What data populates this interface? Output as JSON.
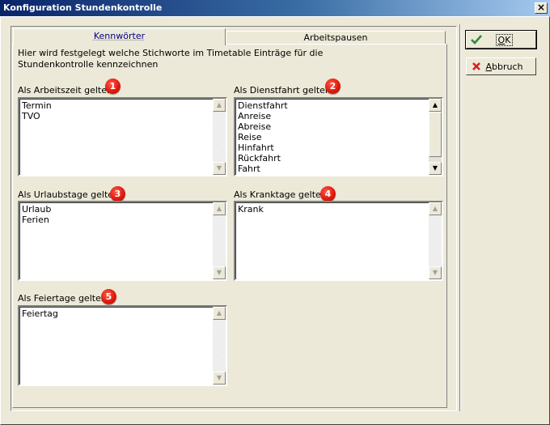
{
  "window": {
    "title": "Konfiguration Stundenkontrolle",
    "close_glyph": "×"
  },
  "tabs": [
    {
      "label": "Kennwörter",
      "active": true
    },
    {
      "label": "Arbeitspausen",
      "active": false
    }
  ],
  "description": "Hier wird festgelegt welche Stichworte im Timetable Einträge für die Stundenkontrolle kennzeichnen",
  "groups": {
    "arbeitszeit": {
      "label": "Als Arbeitszeit gelten:",
      "badge": "1",
      "items": [
        "Termin",
        "TVO"
      ]
    },
    "dienstfahrt": {
      "label": "Als Dienstfahrt gelten:",
      "badge": "2",
      "items": [
        "Dienstfahrt",
        "Anreise",
        "Abreise",
        "Reise",
        "Hinfahrt",
        "Rückfahrt",
        "Fahrt"
      ]
    },
    "urlaubstage": {
      "label": "Als Urlaubstage gelten:",
      "badge": "3",
      "items": [
        "Urlaub",
        "Ferien"
      ]
    },
    "kranktage": {
      "label": "Als Kranktage gelten:",
      "badge": "4",
      "items": [
        "Krank"
      ]
    },
    "feiertage": {
      "label": "Als Feiertage gelten:",
      "badge": "5",
      "items": [
        "Feiertag"
      ]
    }
  },
  "buttons": {
    "ok": {
      "mnemonic": "O",
      "rest": "K",
      "icon": "checkmark-icon",
      "icon_color": "#2e8b2e"
    },
    "cancel": {
      "mnemonic": "A",
      "rest": "bbruch",
      "icon": "x-icon",
      "icon_color": "#d42020"
    }
  },
  "colors": {
    "badge": "#e11a0c",
    "active_tab_text": "#000080",
    "titlebar_start": "#0a246a"
  }
}
